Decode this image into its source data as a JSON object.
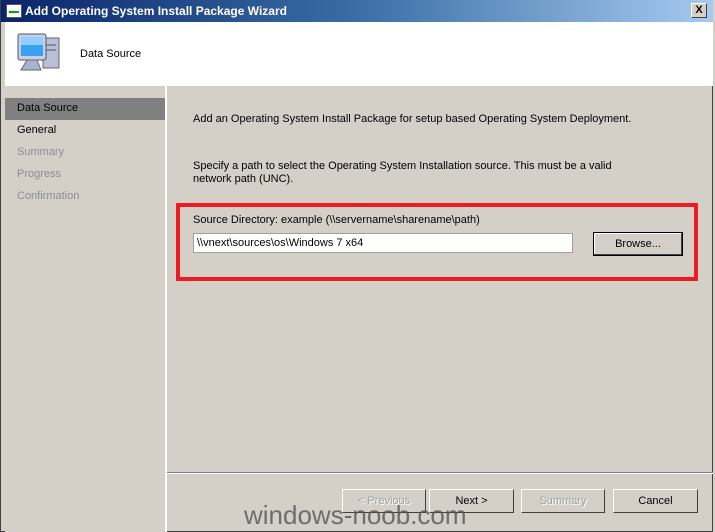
{
  "window": {
    "title": "Add Operating System Install Package Wizard",
    "close_label": "X"
  },
  "header": {
    "title": "Data Source",
    "icon": "computer-icon"
  },
  "nav": {
    "items": [
      {
        "label": "Data Source",
        "state": "active"
      },
      {
        "label": "General",
        "state": "enabled"
      },
      {
        "label": "Summary",
        "state": "disabled"
      },
      {
        "label": "Progress",
        "state": "disabled"
      },
      {
        "label": "Confirmation",
        "state": "disabled"
      }
    ]
  },
  "content": {
    "intro": "Add an Operating System Install Package for setup based Operating System Deployment.",
    "instruction": "Specify a path to select the Operating System Installation source. This must be a valid network path (UNC).",
    "source_label": "Source Directory: example (\\\\servername\\sharename\\path)",
    "source_value": "\\\\vnext\\sources\\os\\Windows 7 x64",
    "browse_label": "Browse...",
    "highlight_color": "#ed1c24"
  },
  "footer": {
    "previous": "< Previous",
    "next": "Next >",
    "summary": "Summary",
    "cancel": "Cancel"
  },
  "watermark": "windows-noob.com"
}
